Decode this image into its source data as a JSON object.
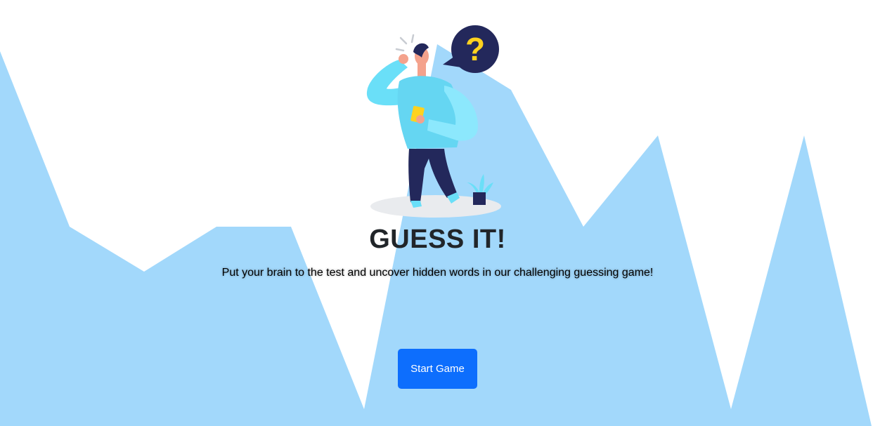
{
  "hero": {
    "title": "GUESS IT!",
    "subtitle": "Put your brain to the test and uncover hidden words in our challenging guessing game!",
    "illustration_icon": "confused-person-question-icon",
    "speech_bubble_text": "?"
  },
  "actions": {
    "start_label": "Start Game"
  },
  "colors": {
    "background": "#ffffff",
    "mountains": "#a2d8fb",
    "button": "#0d6efd",
    "title": "#212529",
    "bubble": "#23285b",
    "question_mark": "#ffd21f"
  }
}
